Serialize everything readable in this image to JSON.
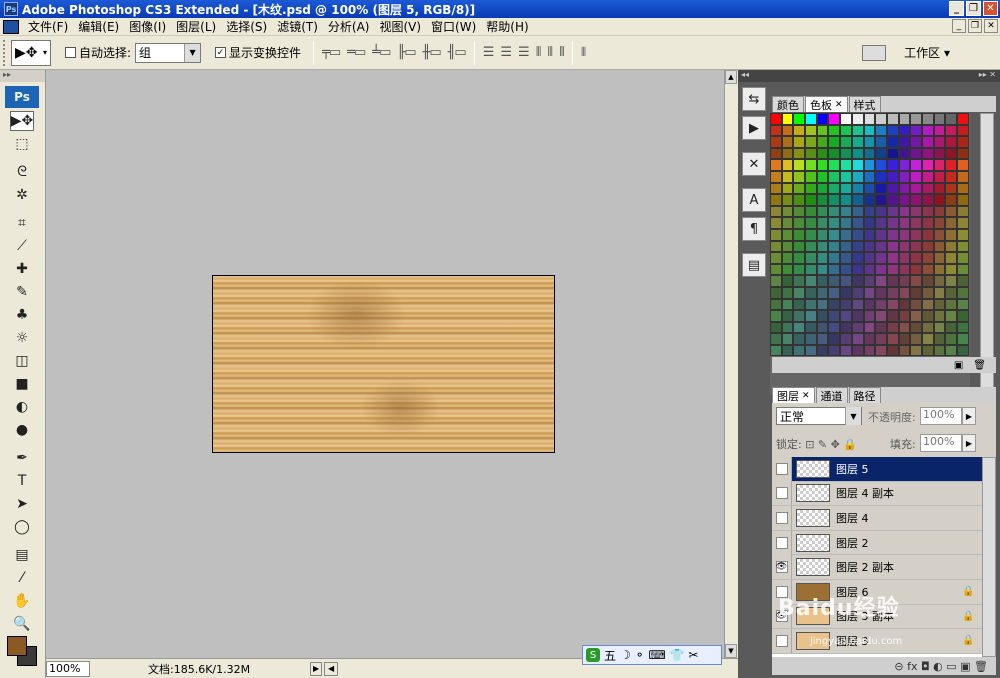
{
  "window": {
    "title": "Adobe Photoshop CS3 Extended - [木纹.psd @ 100% (图层 5, RGB/8)]",
    "min": "_",
    "max": "❐",
    "close": "✕"
  },
  "menu": [
    "文件(F)",
    "编辑(E)",
    "图像(I)",
    "图层(L)",
    "选择(S)",
    "滤镜(T)",
    "分析(A)",
    "视图(V)",
    "窗口(W)",
    "帮助(H)"
  ],
  "options": {
    "auto_select_label": "自动选择:",
    "auto_select_value": "组",
    "show_transform_label": "显示变换控件",
    "workspace_label": "工作区 ▾"
  },
  "tools": [
    "move-tool",
    "marquee-tool",
    "lasso-tool",
    "magic-wand-tool",
    "crop-tool",
    "eyedropper-tool",
    "healing-tool",
    "brush-tool",
    "stamp-tool",
    "history-brush-tool",
    "eraser-tool",
    "gradient-tool",
    "blur-tool",
    "dodge-tool",
    "pen-tool",
    "type-tool",
    "path-select-tool",
    "shape-tool",
    "notes-tool",
    "eyedropper2-tool",
    "hand-tool",
    "zoom-tool"
  ],
  "tool_glyphs": [
    "▶✥",
    "⬚",
    "ᘓ",
    "✲",
    "⌗",
    "⟋",
    "✚",
    "✎",
    "♣",
    "☼",
    "◫",
    "■",
    "◐",
    "●",
    "✒",
    "T",
    "➤",
    "◯",
    "▤",
    "⁄",
    "✋",
    "🔍"
  ],
  "colors": {
    "foreground": "#8b5a24",
    "background": "#3a3a3a"
  },
  "statusbar": {
    "zoom": "100%",
    "doc": "文档:185.6K/1.32M"
  },
  "ime": {
    "label": "五",
    "icons": "☽ ⚬ ⌨ 👕 ✂"
  },
  "swatch_panel": {
    "tabs": [
      "颜色",
      "色板",
      "样式"
    ],
    "active": "色板"
  },
  "layers_panel": {
    "tabs": [
      "图层",
      "通道",
      "路径"
    ],
    "blend_mode": "正常",
    "opacity_label": "不透明度:",
    "opacity": "100%",
    "lock_label": "锁定:",
    "lock_icons": "⊡ ✎ ✥ 🔒",
    "fill_label": "填充:",
    "fill": "100%",
    "rows": [
      {
        "name": "图层 5",
        "visible": false,
        "thumb": "checker",
        "selected": true,
        "locked": false
      },
      {
        "name": "图层 4 副本",
        "visible": false,
        "thumb": "checker",
        "selected": false,
        "locked": false
      },
      {
        "name": "图层 4",
        "visible": false,
        "thumb": "checker",
        "selected": false,
        "locked": false
      },
      {
        "name": "图层 2",
        "visible": false,
        "thumb": "checker",
        "selected": false,
        "locked": false
      },
      {
        "name": "图层 2 副本",
        "visible": true,
        "thumb": "checker",
        "selected": false,
        "locked": false
      },
      {
        "name": "图层 6",
        "visible": false,
        "thumb": "brown",
        "selected": false,
        "locked": true
      },
      {
        "name": "图层 3 副本",
        "visible": true,
        "thumb": "light",
        "selected": false,
        "locked": true
      },
      {
        "name": "图层 3",
        "visible": false,
        "thumb": "light",
        "selected": false,
        "locked": true
      }
    ],
    "footer_icons": "⊝ fx ◘ ◐ ▭ ▣ 🗑"
  },
  "watermark": {
    "main": "Baidu经验",
    "sub": "jingyan.baidu.com"
  }
}
